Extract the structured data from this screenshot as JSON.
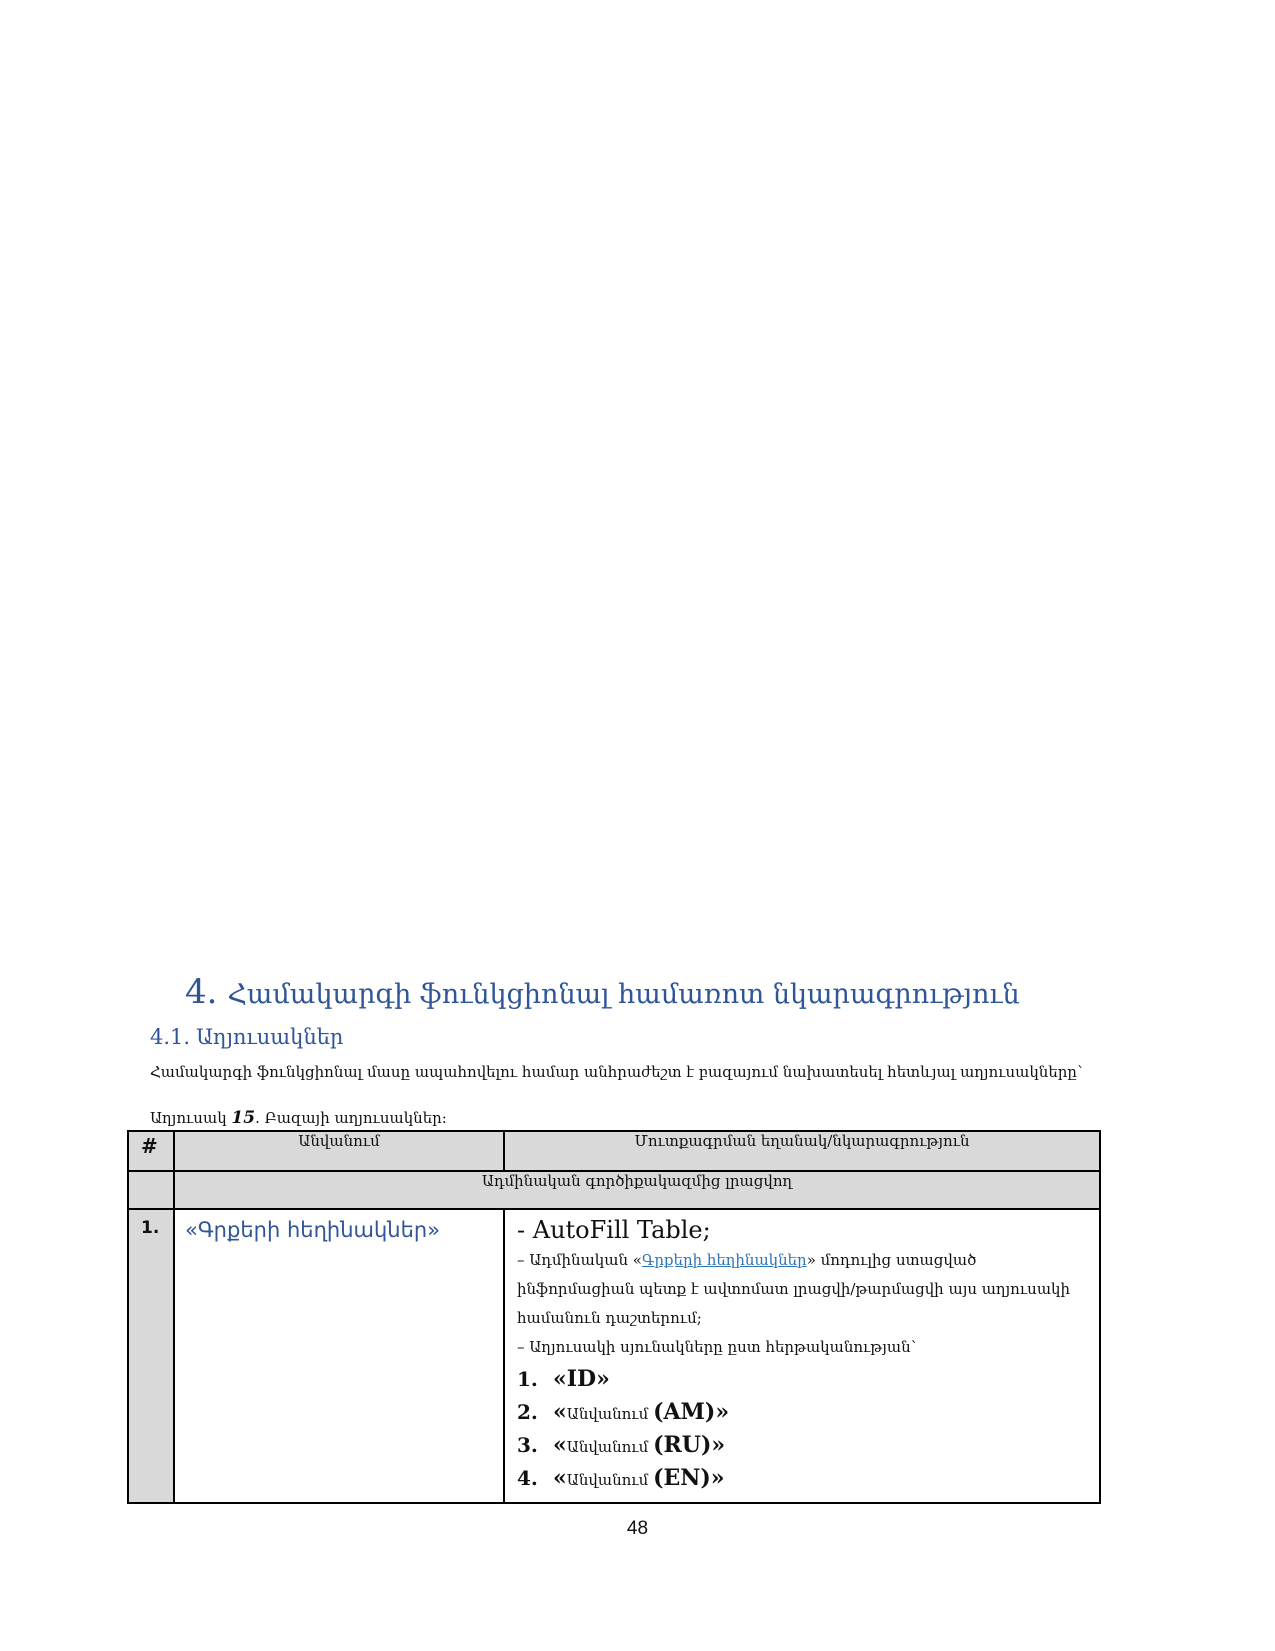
{
  "section": {
    "number": "4.",
    "title": "Համակարգի ֆունկցիոնալ համառոտ նկարագրություն"
  },
  "subsection": {
    "number": "4.1.",
    "title": "Աղյուսակներ"
  },
  "intro": "Համակարգի ֆունկցիոնալ մասը ապահովելու համար անհրաժեշտ է բազայում նախատեսել հետևյալ աղյուսակները՝",
  "caption": {
    "prefix": "Աղյուսակ",
    "number": "15",
    "text": ". Բազայի աղյուսակներ:"
  },
  "table": {
    "headers": {
      "num": "#",
      "name": "Անվանում",
      "desc": "Մուտքագրման եղանակ/նկարագրություն"
    },
    "group": "Ադմինական գործիքակազմից լրացվող",
    "rows": [
      {
        "index": "1.",
        "name": "«Գրքերի հեղինակներ»",
        "desc_line1": "- AutoFill Table;",
        "desc_line2_prefix": "– Ադմինական «",
        "desc_line2_link": "Գրքերի հեղինակներ",
        "desc_line2_suffix": "» մոդուլից ստացված",
        "desc_line3": "ինֆորմացիան պետք է ավտոմատ լրացվի/թարմացվի այս աղյուսակի",
        "desc_line4": "համանուն դաշտերում;",
        "desc_line5": "– Աղյուսակի սյունակները ըստ հերթականության՝",
        "columns": [
          {
            "n": "1.",
            "label": "",
            "code": "ID"
          },
          {
            "n": "2.",
            "label": "Անվանում ",
            "code": "(AM)"
          },
          {
            "n": "3.",
            "label": "Անվանում ",
            "code": "(RU)"
          },
          {
            "n": "4.",
            "label": "Անվանում ",
            "code": "(EN)"
          }
        ]
      }
    ]
  },
  "page_number": "48",
  "colors": {
    "heading": "#2f5597",
    "link": "#2e75b6",
    "header_fill": "#d9d9d9"
  }
}
